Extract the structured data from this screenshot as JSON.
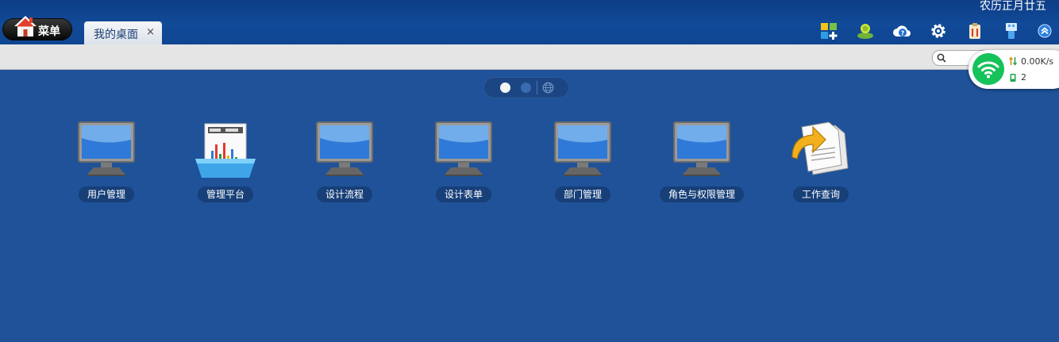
{
  "header": {
    "lunar_date": "农历正月廿五",
    "menu_label": "菜单",
    "tab": {
      "label": "我的桌面",
      "close": "×"
    }
  },
  "toolbar": {
    "icons": [
      "apps-add-icon",
      "user-online-icon",
      "cloud-help-icon",
      "gear-icon",
      "clipboard-icon",
      "usb-icon",
      "collapse-up-icon"
    ]
  },
  "network": {
    "speed": "0.00K/s",
    "connections": "2"
  },
  "desktop": {
    "icons": [
      {
        "label": "用户管理",
        "type": "monitor"
      },
      {
        "label": "管理平台",
        "type": "dashboard"
      },
      {
        "label": "设计流程",
        "type": "monitor"
      },
      {
        "label": "设计表单",
        "type": "monitor"
      },
      {
        "label": "部门管理",
        "type": "monitor"
      },
      {
        "label": "角色与权限管理",
        "type": "monitor"
      },
      {
        "label": "工作查询",
        "type": "documents"
      }
    ]
  },
  "pager": {
    "pages": 2,
    "current": 1
  },
  "colors": {
    "desktop_bg": "#1f5299",
    "topbar": "#114a98",
    "label_bg": "#173f78",
    "wifi_green": "#15c35a"
  }
}
